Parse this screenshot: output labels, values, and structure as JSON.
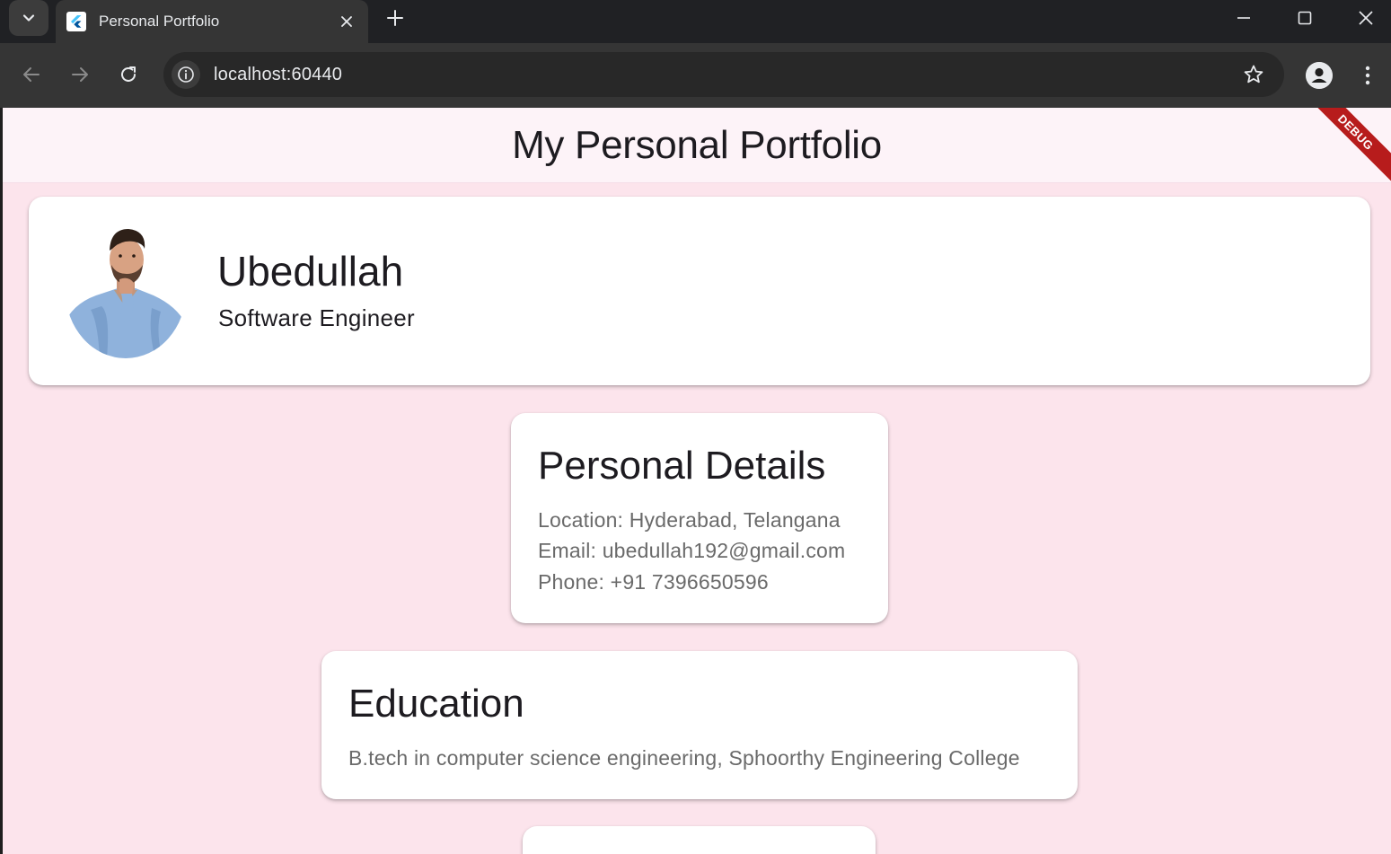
{
  "browser": {
    "tab_title": "Personal Portfolio",
    "url": "localhost:60440"
  },
  "app": {
    "title": "My Personal Portfolio",
    "debug_banner": "DEBUG"
  },
  "profile": {
    "name": "Ubedullah",
    "role": "Software Engineer"
  },
  "personal_details": {
    "heading": "Personal Details",
    "lines": [
      "Location: Hyderabad, Telangana",
      "Email: ubedullah192@gmail.com",
      "Phone: +91 7396650596"
    ]
  },
  "education": {
    "heading": "Education",
    "text": "B.tech in computer science engineering, Sphoorthy Engineering College"
  },
  "colors": {
    "background": "#fce4ec",
    "appbar": "#fdf3f8",
    "card": "#ffffff",
    "debug": "#b71c1c"
  }
}
